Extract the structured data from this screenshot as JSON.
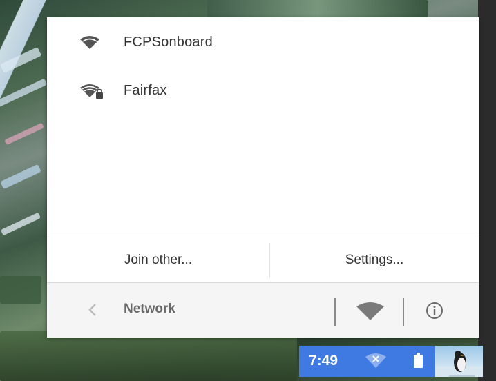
{
  "networks": [
    {
      "name": "FCPSonboard",
      "secured": false,
      "icon": "wifi-icon"
    },
    {
      "name": "Fairfax",
      "secured": true,
      "icon": "wifi-lock-icon"
    }
  ],
  "actions": {
    "join_other": "Join other...",
    "settings": "Settings..."
  },
  "footer": {
    "back_icon": "chevron-left-icon",
    "title": "Network",
    "wifi_icon": "wifi-icon",
    "info_icon": "info-icon"
  },
  "tray": {
    "time": "7:49",
    "wifi_icon": "wifi-disconnected-icon",
    "battery_icon": "battery-icon",
    "avatar_icon": "user-avatar"
  },
  "colors": {
    "tray_bg": "#3f7ae3",
    "popup_bg": "#ffffff",
    "footer_bg": "#f5f5f5",
    "icon_gray": "#555555"
  }
}
